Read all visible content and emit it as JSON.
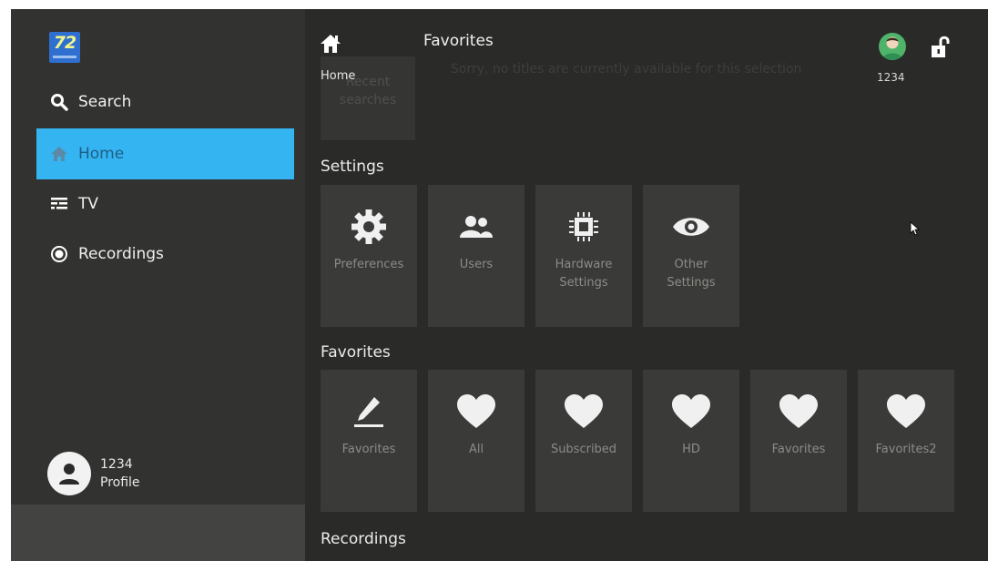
{
  "sidebar": {
    "logo_text": "72",
    "items": [
      {
        "label": "Search",
        "icon": "search-icon"
      },
      {
        "label": "Home",
        "icon": "home-icon",
        "active": true
      },
      {
        "label": "TV",
        "icon": "tv-guide-icon"
      },
      {
        "label": "Recordings",
        "icon": "record-icon"
      }
    ],
    "profile": {
      "number": "1234",
      "label": "Profile"
    }
  },
  "header": {
    "title": "Favorites",
    "user_number": "1234"
  },
  "main": {
    "home_label": "Home",
    "ghost_message": "Sorry, no titles are currently available for this selection",
    "recent_tile_label": [
      "Recent",
      "searches"
    ],
    "sections": [
      {
        "title": "Settings",
        "tiles": [
          {
            "label": [
              "Preferences"
            ],
            "icon": "gear-icon"
          },
          {
            "label": [
              "Users"
            ],
            "icon": "users-icon"
          },
          {
            "label": [
              "Hardware",
              "Settings"
            ],
            "icon": "chip-icon"
          },
          {
            "label": [
              "Other",
              "Settings"
            ],
            "icon": "eye-icon"
          }
        ]
      },
      {
        "title": "Favorites",
        "tiles": [
          {
            "label": [
              "Favorites"
            ],
            "icon": "pencil-icon"
          },
          {
            "label": [
              "All"
            ],
            "icon": "heart-icon"
          },
          {
            "label": [
              "Subscribed"
            ],
            "icon": "heart-icon"
          },
          {
            "label": [
              "HD"
            ],
            "icon": "heart-icon"
          },
          {
            "label": [
              "Favorites"
            ],
            "icon": "heart-icon"
          },
          {
            "label": [
              "Favorites2"
            ],
            "icon": "heart-icon"
          }
        ]
      },
      {
        "title": "Recordings"
      }
    ]
  },
  "colors": {
    "active": "#35b4f2",
    "background": "#2a2a28",
    "sidebar": "#323230",
    "tile": "#3a3a38"
  }
}
